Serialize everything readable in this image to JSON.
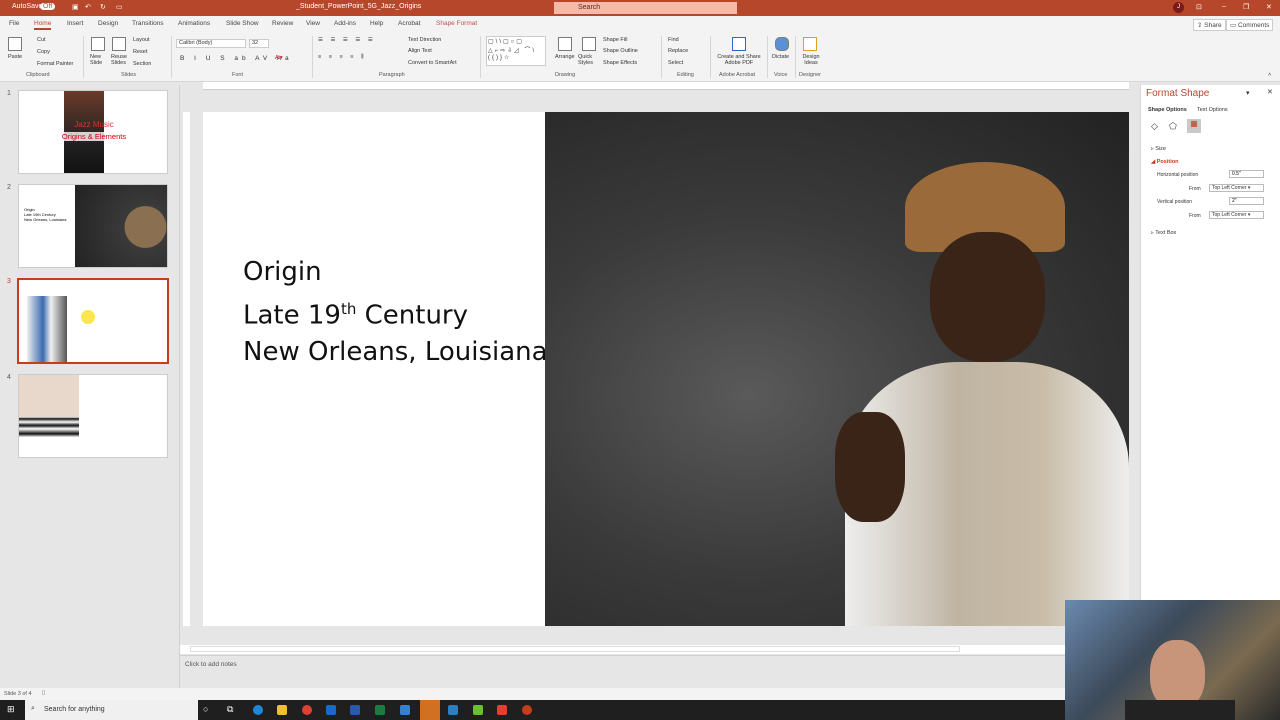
{
  "titlebar": {
    "autosave": "AutoSave",
    "autosave_state": "Off",
    "filename": "_Student_PowerPoint_5G_Jazz_Origins",
    "search_placeholder": "Search",
    "user_initial": "J"
  },
  "tabs": [
    "File",
    "Home",
    "Insert",
    "Design",
    "Transitions",
    "Animations",
    "Slide Show",
    "Review",
    "View",
    "Add-ins",
    "Help",
    "Acrobat",
    "Shape Format"
  ],
  "share": "Share",
  "comments": "Comments",
  "ribbon": {
    "clipboard": {
      "label": "Clipboard",
      "paste": "Paste",
      "cut": "Cut",
      "copy": "Copy",
      "format_painter": "Format Painter"
    },
    "slides": {
      "label": "Slides",
      "new_slide": "New Slide",
      "reuse_slides": "Reuse Slides",
      "layout": "Layout",
      "reset": "Reset",
      "section": "Section"
    },
    "font": {
      "label": "Font",
      "font_name": "Calibri (Body)",
      "font_size": "32"
    },
    "paragraph": {
      "label": "Paragraph",
      "text_direction": "Text Direction",
      "align_text": "Align Text",
      "convert_smartart": "Convert to SmartArt"
    },
    "drawing": {
      "label": "Drawing",
      "arrange": "Arrange",
      "quick_styles": "Quick Styles",
      "shape_fill": "Shape Fill",
      "shape_outline": "Shape Outline",
      "shape_effects": "Shape Effects"
    },
    "editing": {
      "label": "Editing",
      "find": "Find",
      "replace": "Replace",
      "select": "Select"
    },
    "acrobat": {
      "label": "Adobe Acrobat",
      "create_share": "Create and Share Adobe PDF"
    },
    "voice": {
      "label": "Voice",
      "dictate": "Dictate"
    },
    "designer": {
      "label": "Designer",
      "design_ideas": "Design Ideas"
    }
  },
  "thumbnails": [
    {
      "num": "1",
      "title": "Jazz Music",
      "subtitle": "Origins & Elements"
    },
    {
      "num": "2",
      "lines": [
        "Origin",
        "Late 19th Century",
        "New Orleans, Louisiana"
      ]
    },
    {
      "num": "3"
    },
    {
      "num": "4"
    }
  ],
  "slide": {
    "line1": "Origin",
    "line2_pre": "Late 19",
    "line2_sup": "th",
    "line2_post": " Century",
    "line3": "New Orleans, Louisiana"
  },
  "format_pane": {
    "title": "Format Shape",
    "tab_shape": "Shape Options",
    "tab_text": "Text Options",
    "size": "Size",
    "position": "Position",
    "h_pos_label": "Horizontal position",
    "h_pos_value": "0.5\"",
    "from1_label": "From",
    "from1_value": "Top Left Corner",
    "v_pos_label": "Vertical position",
    "v_pos_value": "2\"",
    "from2_label": "From",
    "from2_value": "Top Left Corner",
    "text_box": "Text Box"
  },
  "notes_placeholder": "Click to add notes",
  "status": {
    "slide_count": "Slide 3 of 4"
  },
  "taskbar": {
    "search_placeholder": "Search for anything"
  },
  "colors": {
    "accent": "#b7472a",
    "selection": "#c43e1c"
  }
}
